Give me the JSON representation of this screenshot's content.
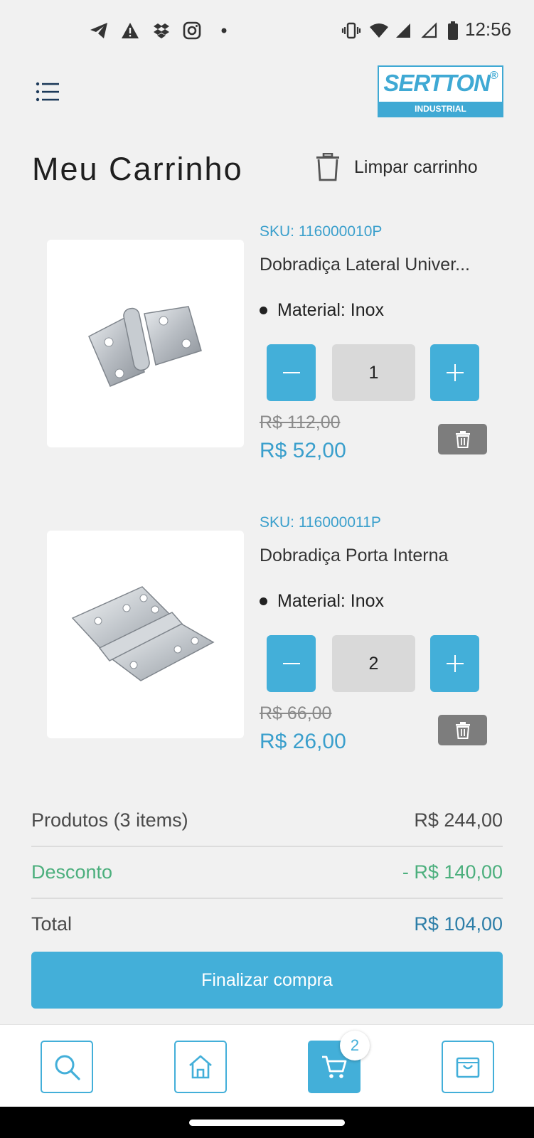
{
  "status_bar": {
    "time": "12:56",
    "left_icons": [
      "telegram-icon",
      "warning-icon",
      "dropbox-icon",
      "instagram-icon",
      "dot-icon"
    ],
    "right_icons": [
      "vibrate-icon",
      "wifi-icon",
      "signal-icon",
      "signal-empty-icon",
      "battery-icon"
    ]
  },
  "header": {
    "menu_icon": "list-menu-icon",
    "logo": {
      "brand": "SERTTON",
      "reg": "®",
      "subtitle": "INDUSTRIAL"
    }
  },
  "page": {
    "title": "Meu Carrinho",
    "clear_cart_label": "Limpar carrinho"
  },
  "cart_items": [
    {
      "sku": "SKU: 116000010P",
      "name": "Dobradiça Lateral Univer...",
      "spec": "Material: Inox",
      "quantity": "1",
      "old_price": "R$ 112,00",
      "price": "R$ 52,00"
    },
    {
      "sku": "SKU: 116000011P",
      "name": "Dobradiça Porta Interna",
      "spec": "Material: Inox",
      "quantity": "2",
      "old_price": "R$ 66,00",
      "price": "R$ 26,00"
    }
  ],
  "summary": {
    "products_label": "Produtos (3 items)",
    "products_value": "R$ 244,00",
    "discount_label": "Desconto",
    "discount_value": "- R$ 140,00",
    "total_label": "Total",
    "total_value": "R$ 104,00"
  },
  "checkout_label": "Finalizar compra",
  "bottom_nav": {
    "items": [
      "search-icon",
      "home-icon",
      "cart-icon",
      "bag-icon"
    ],
    "cart_badge": "2"
  },
  "colors": {
    "accent": "#43afd9",
    "sku_blue": "#3a9fcc",
    "discount_green": "#4caf7d",
    "total_blue": "#2d7ea8",
    "delete_gray": "#7d7d7d"
  }
}
